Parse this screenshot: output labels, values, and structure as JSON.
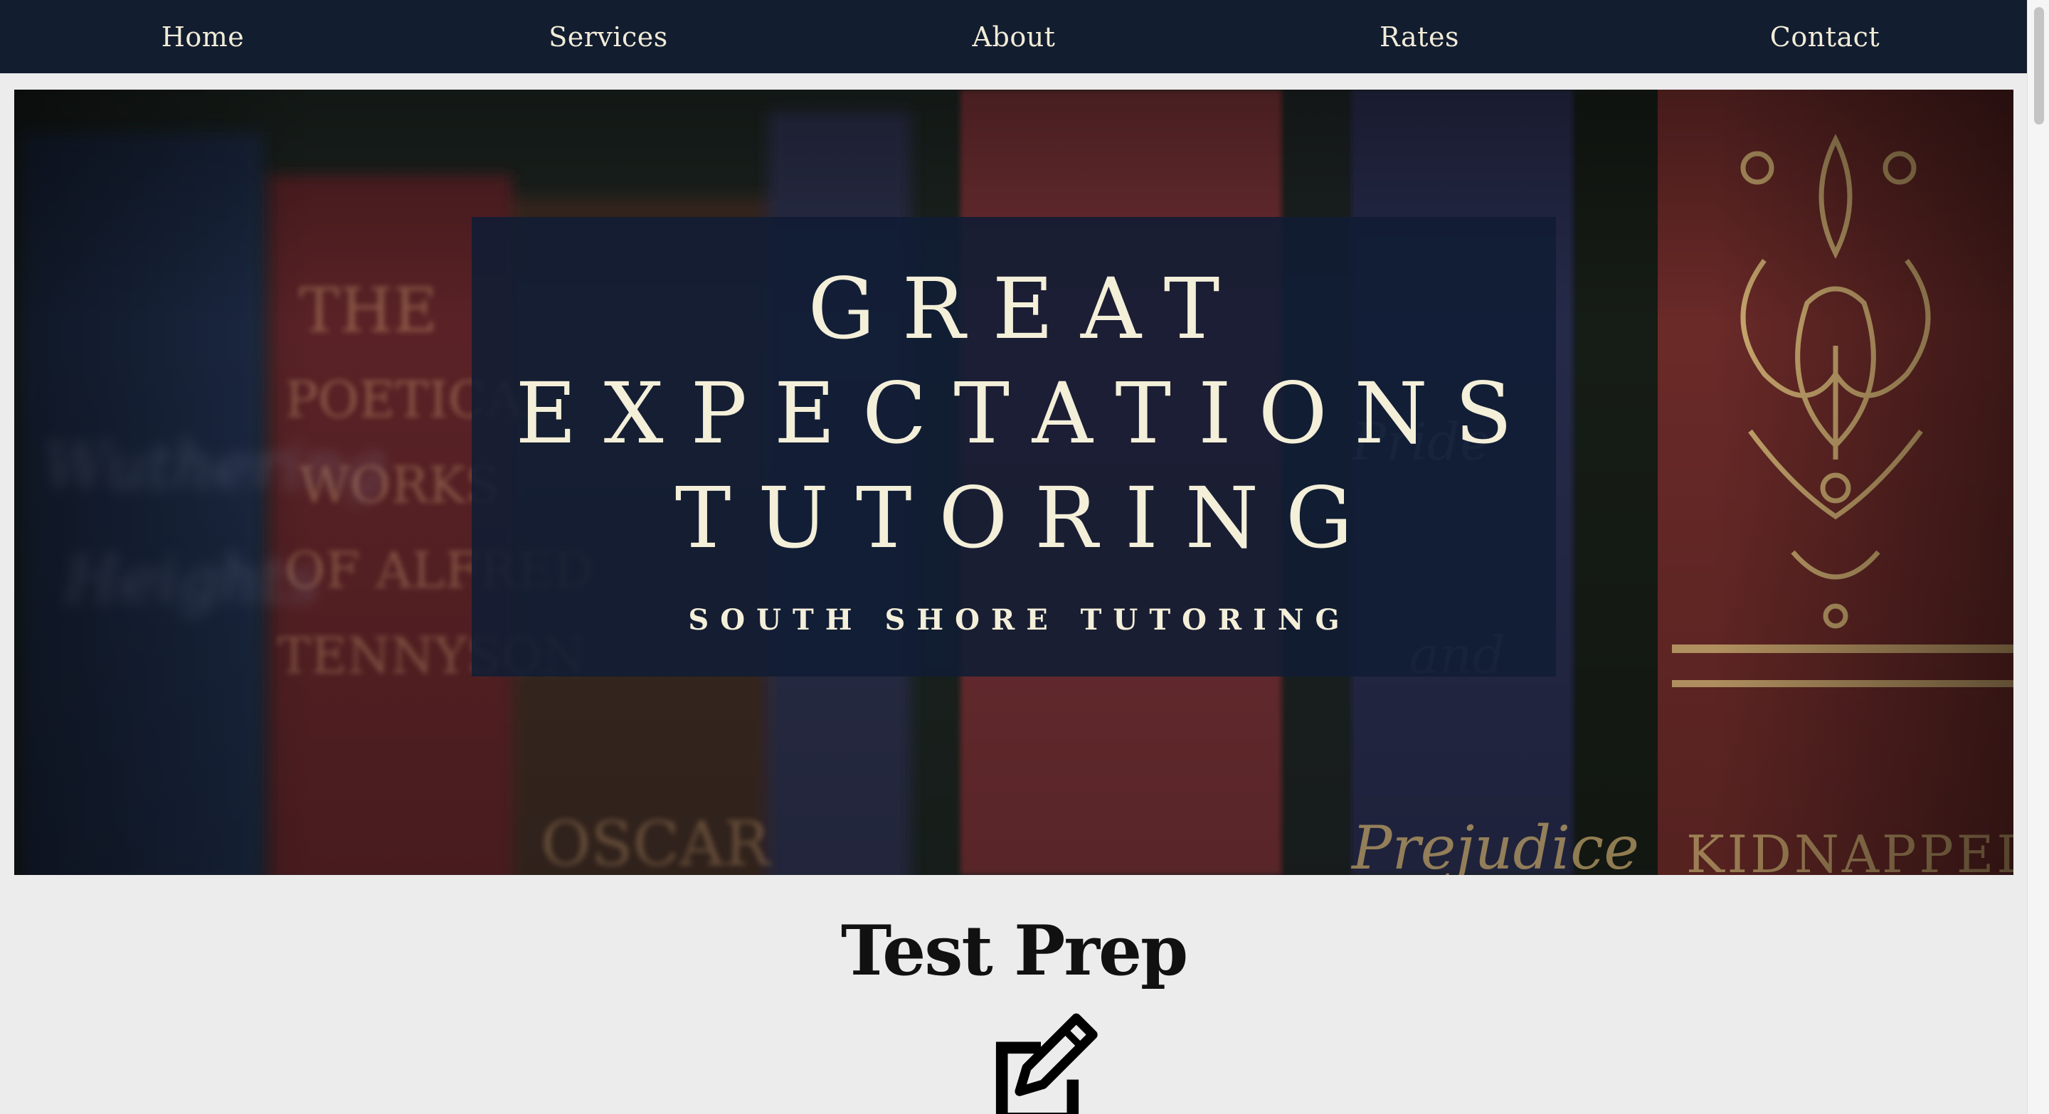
{
  "nav": {
    "items": [
      {
        "label": "Home"
      },
      {
        "label": "Services"
      },
      {
        "label": "About"
      },
      {
        "label": "Rates"
      },
      {
        "label": "Contact"
      }
    ]
  },
  "hero": {
    "title_lines": [
      "GREAT",
      "EXPECTATIONS",
      "TUTORING"
    ],
    "tagline": "SOUTH SHORE TUTORING",
    "background": "bookshelf-photo",
    "book_spine_text": [
      "Wuthering Heights",
      "THE POETICAL WORKS OF ALFRED TENNYSON",
      "OSCAR",
      "Pride and Prejudice",
      "KIDNAPPED"
    ]
  },
  "section": {
    "title": "Test Prep",
    "icon": "edit-icon"
  },
  "colors": {
    "nav_bg": "#131d30",
    "title_box": "#101c34",
    "cream_text": "#f4efd9",
    "page_bg": "#ececec"
  }
}
